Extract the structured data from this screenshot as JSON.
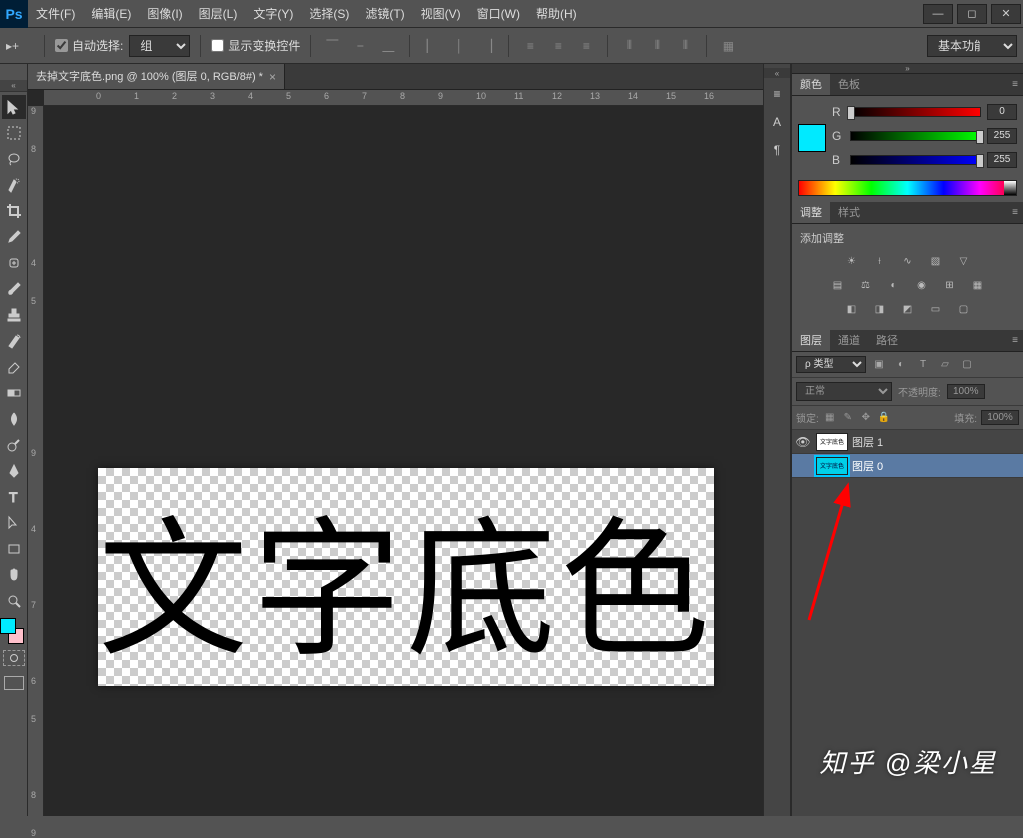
{
  "menubar": {
    "items": [
      "文件(F)",
      "编辑(E)",
      "图像(I)",
      "图层(L)",
      "文字(Y)",
      "选择(S)",
      "滤镜(T)",
      "视图(V)",
      "窗口(W)",
      "帮助(H)"
    ]
  },
  "options": {
    "auto_select_label": "自动选择:",
    "auto_select_value": "组",
    "show_transform_label": "显示变换控件",
    "workspace": "基本功能"
  },
  "document": {
    "tab_title": "去掉文字底色.png @ 100% (图层 0, RGB/8#) *",
    "canvas_text": "文字底色"
  },
  "ruler_h": [
    "0",
    "1",
    "2",
    "3",
    "4",
    "5",
    "6",
    "7",
    "8",
    "9",
    "10",
    "11",
    "12",
    "13",
    "14",
    "15",
    "16"
  ],
  "ruler_v": [
    "9",
    "8",
    "4",
    "5",
    "9",
    "4",
    "7",
    "6",
    "5",
    "8",
    "9"
  ],
  "panels": {
    "color_tab": "颜色",
    "swatches_tab": "色板",
    "r_label": "R",
    "r_val": "0",
    "g_label": "G",
    "g_val": "255",
    "b_label": "B",
    "b_val": "255",
    "adjust_tab": "调整",
    "styles_tab": "样式",
    "add_adjust_label": "添加调整",
    "layers_tab": "图层",
    "channels_tab": "通道",
    "paths_tab": "路径",
    "filter_kind": "ρ 类型",
    "blend_mode": "正常",
    "opacity_label": "不透明度:",
    "opacity_val": "100%",
    "lock_label": "锁定:",
    "fill_label": "填充:",
    "fill_val": "100%",
    "layer1_name": "图层 1",
    "layer0_name": "图层 0"
  },
  "watermark": "知乎  @梁小星",
  "icons": {
    "ps": "Ps"
  }
}
